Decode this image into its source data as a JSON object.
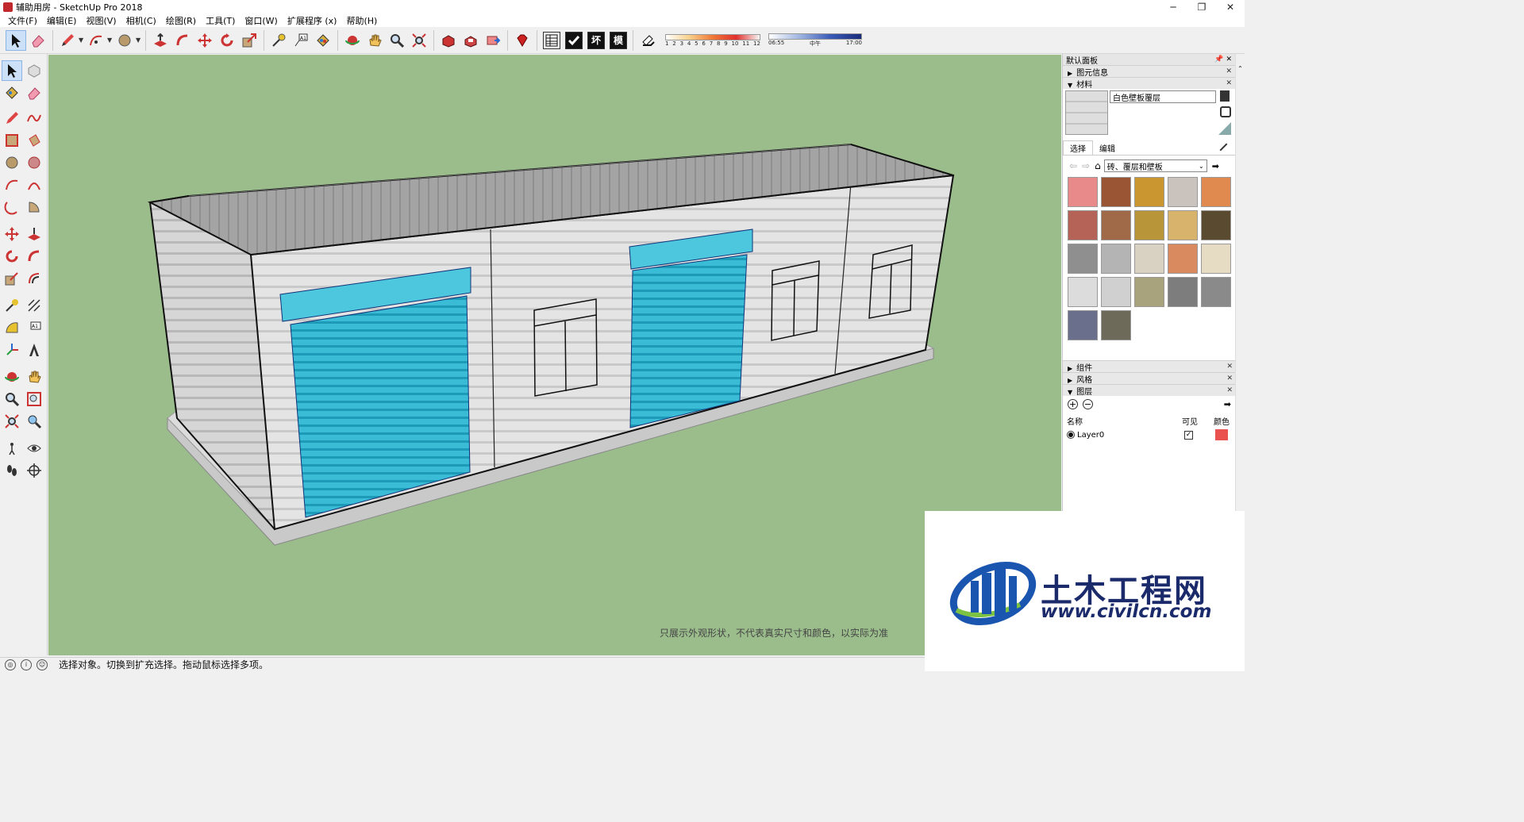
{
  "window": {
    "title": "辅助用房 - SketchUp Pro 2018",
    "controls": [
      "─",
      "❐",
      "✕"
    ]
  },
  "menu": [
    "文件(F)",
    "编辑(E)",
    "视图(V)",
    "相机(C)",
    "绘图(R)",
    "工具(T)",
    "窗口(W)",
    "扩展程序 (x)",
    "帮助(H)"
  ],
  "toolbar": {
    "report_buttons": [
      "",
      "",
      "坏",
      "模"
    ],
    "shadow_ticks": [
      "1",
      "2",
      "3",
      "4",
      "5",
      "6",
      "7",
      "8",
      "9",
      "10",
      "11",
      "12"
    ],
    "time_ticks": [
      "06:55",
      "中午",
      "17:00"
    ]
  },
  "tray": {
    "title": "默认面板",
    "entity_info": "图元信息",
    "materials": "材料",
    "material_name": "白色壁板覆层",
    "tab_select": "选择",
    "tab_edit": "编辑",
    "library": "砖、覆层和壁板",
    "components": "组件",
    "styles": "风格",
    "layers": "图层",
    "layer_col_name": "名称",
    "layer_col_visible": "可见",
    "layer_col_color": "颜色",
    "layer_name": "Layer0",
    "layer_color": "#e9524f"
  },
  "swatches": [
    "#e98a8a",
    "#9a5634",
    "#c9962f",
    "#c9c2bd",
    "#e18a4f",
    "#b56356",
    "#a06a48",
    "#b89538",
    "#d8b36c",
    "#5a4a30",
    "#8f8f8f",
    "#b4b4b4",
    "#d9d2c3",
    "#d98a5e",
    "#e6dcc4",
    "#dcdcdc",
    "#d0d0d0",
    "#a8a27d",
    "#7d7d7d",
    "#8a8a8a",
    "#6a6f8c",
    "#6d6a5a"
  ],
  "viewport": {
    "disclaimer": "只展示外观形状，不代表真实尺寸和颜色，以实际为准",
    "sky_color": "#9bbd8c"
  },
  "logo": {
    "text_cn": "土木工程网",
    "url": "www.civilcn.com"
  },
  "status": {
    "text": "选择对象。切换到扩充选择。拖动鼠标选择多项。"
  }
}
